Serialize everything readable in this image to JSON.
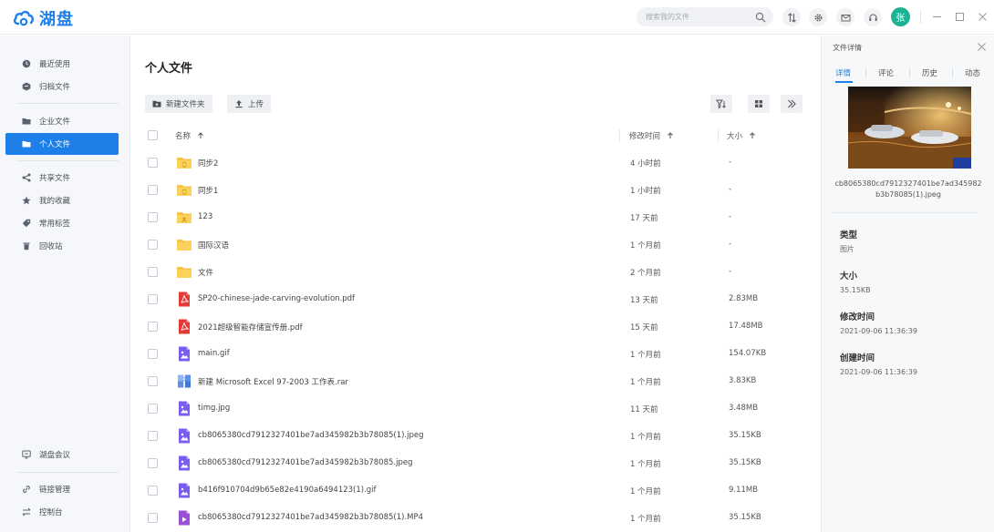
{
  "app": {
    "name": "湖盘",
    "brand_color": "#1e7fe8",
    "accent_active": "#1e7fe8"
  },
  "header": {
    "search_placeholder": "搜索我的文件",
    "icons": [
      "sort-arrows-icon",
      "gear-icon",
      "mail-icon",
      "headset-icon"
    ],
    "avatar_text": "张",
    "avatar_color": "#1bb394"
  },
  "sidebar": {
    "items": [
      {
        "label": "最近使用",
        "icon": "clock-icon"
      },
      {
        "label": "归档文件",
        "icon": "archive-icon"
      },
      {
        "label": "企业文件",
        "icon": "folder-icon"
      },
      {
        "label": "个人文件",
        "icon": "folder-open-icon",
        "active": true
      },
      {
        "label": "共享文件",
        "icon": "share-icon"
      },
      {
        "label": "我的收藏",
        "icon": "star-icon"
      },
      {
        "label": "常用标签",
        "icon": "tag-icon"
      },
      {
        "label": "回收站",
        "icon": "trash-icon"
      }
    ],
    "bottom_items": [
      {
        "label": "湖盘会议",
        "icon": "meeting-icon"
      },
      {
        "label": "链接管理",
        "icon": "link-icon"
      },
      {
        "label": "控制台",
        "icon": "sliders-icon"
      }
    ]
  },
  "main": {
    "title": "个人文件",
    "new_folder_label": "新建文件夹",
    "upload_label": "上传",
    "columns": {
      "name": "名称",
      "modified": "修改时间",
      "size": "大小"
    },
    "rows": [
      {
        "name": "同步2",
        "modified": "4 小时前",
        "size": "-",
        "type": "sync-folder"
      },
      {
        "name": "同步1",
        "modified": "1 小时前",
        "size": "-",
        "type": "sync-folder"
      },
      {
        "name": "123",
        "modified": "17 天前",
        "size": "-",
        "type": "shared-folder"
      },
      {
        "name": "国际汉语",
        "modified": "1 个月前",
        "size": "-",
        "type": "folder"
      },
      {
        "name": "文件",
        "modified": "2 个月前",
        "size": "-",
        "type": "folder"
      },
      {
        "name": "SP20-chinese-jade-carving-evolution.pdf",
        "modified": "13 天前",
        "size": "2.83MB",
        "type": "pdf"
      },
      {
        "name": "2021超级智能存储宣传册.pdf",
        "modified": "15 天前",
        "size": "17.48MB",
        "type": "pdf"
      },
      {
        "name": "main.gif",
        "modified": "1 个月前",
        "size": "154.07KB",
        "type": "image"
      },
      {
        "name": "新建 Microsoft Excel 97-2003 工作表.rar",
        "modified": "1 个月前",
        "size": "3.83KB",
        "type": "archive"
      },
      {
        "name": "timg.jpg",
        "modified": "11 天前",
        "size": "3.48MB",
        "type": "image"
      },
      {
        "name": "cb8065380cd7912327401be7ad345982b3b78085(1).jpeg",
        "modified": "1 个月前",
        "size": "35.15KB",
        "type": "image"
      },
      {
        "name": "cb8065380cd7912327401be7ad345982b3b78085.jpeg",
        "modified": "1 个月前",
        "size": "35.15KB",
        "type": "image"
      },
      {
        "name": "b416f910704d9b65e82e4190a6494123(1).gif",
        "modified": "1 个月前",
        "size": "9.11MB",
        "type": "image"
      },
      {
        "name": "cb8065380cd7912327401be7ad345982b3b78085(1).MP4",
        "modified": "1 个月前",
        "size": "35.15KB",
        "type": "video"
      }
    ]
  },
  "details": {
    "title": "文件详情",
    "tabs": [
      "详情",
      "评论",
      "历史",
      "动态"
    ],
    "active_tab": "详情",
    "file_name": "cb8065380cd7912327401be7ad345982b3b78085(1).jpeg",
    "type_label": "类型",
    "type_value": "图片",
    "size_label": "大小",
    "size_value": "35.15KB",
    "modified_label": "修改时间",
    "modified_value": "2021-09-06 11:36:39",
    "created_label": "创建时间",
    "created_value": "2021-09-06 11:36:39"
  }
}
